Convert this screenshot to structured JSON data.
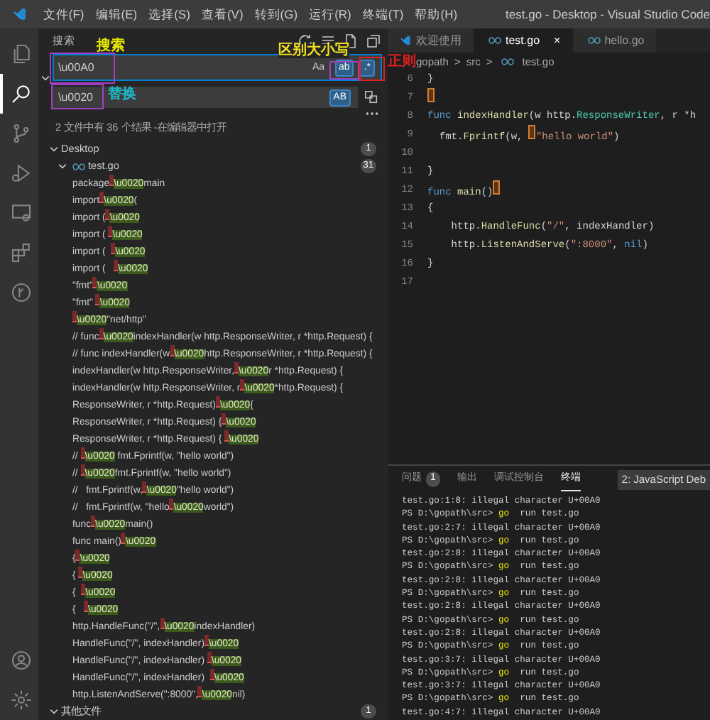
{
  "menu": [
    "文件(F)",
    "编辑(E)",
    "选择(S)",
    "查看(V)",
    "转到(G)",
    "运行(R)",
    "终端(T)",
    "帮助(H)"
  ],
  "window_title": "test.go - Desktop - Visual Studio Code",
  "activity_bar": [
    {
      "kind": "files",
      "selected": false
    },
    {
      "kind": "search",
      "selected": true
    },
    {
      "kind": "branch",
      "selected": false
    },
    {
      "kind": "run",
      "selected": false
    },
    {
      "kind": "monitor",
      "selected": false
    },
    {
      "kind": "extensions",
      "selected": false
    },
    {
      "kind": "fork",
      "selected": false
    }
  ],
  "activity_bottom": [
    {
      "kind": "account"
    },
    {
      "kind": "settings"
    }
  ],
  "sidebar": {
    "title": "搜索",
    "search": {
      "value": "\\u00A0",
      "toggles": [
        {
          "label": "Aa",
          "selected": false
        },
        {
          "label": "ab",
          "selected": true
        },
        {
          "label": ".*",
          "selected": true
        }
      ]
    },
    "replace": {
      "value": "\\u0020",
      "expanded": true,
      "toggles": [
        {
          "label": "AB",
          "selected": true
        }
      ]
    },
    "summary": "2 文件中有 36 个结果 - ",
    "summary_link": "在编辑器中打开",
    "groups": [
      {
        "label": "Desktop",
        "count": "1",
        "expanded": true,
        "files": [
          {
            "label": "test.go",
            "count": "31",
            "expanded": true,
            "matches": [
              {
                "before": "package",
                "replacement": "\\u0020",
                "after": "main"
              },
              {
                "before": "import",
                "replacement": "\\u0020",
                "after": "("
              },
              {
                "before": "import (",
                "replacement": "\\u0020"
              },
              {
                "before": "import ( ",
                "replacement": "\\u0020"
              },
              {
                "before": "import (  ",
                "replacement": "\\u0020"
              },
              {
                "before": "import (   ",
                "replacement": "\\u0020"
              },
              {
                "before": "\"fmt\"",
                "replacement": "\\u0020"
              },
              {
                "before": "\"fmt\" ",
                "replacement": "\\u0020"
              },
              {
                "replacement": "\\u0020",
                "after": "\"net/http\""
              },
              {
                "before": "// func",
                "replacement": "\\u0020",
                "after": "indexHandler(w http.ResponseWriter, r *http.Request) {"
              },
              {
                "before": "// func indexHandler(w",
                "replacement": "\\u0020",
                "after": "http.ResponseWriter, r *http.Request) {"
              },
              {
                "before": "indexHandler(w http.ResponseWriter,",
                "replacement": "\\u0020",
                "after": "r *http.Request) {"
              },
              {
                "before": "indexHandler(w http.ResponseWriter, r",
                "replacement": "\\u0020",
                "after": "*http.Request) {"
              },
              {
                "before": "ResponseWriter, r *http.Request)",
                "replacement": "\\u0020",
                "after": "{"
              },
              {
                "before": "ResponseWriter, r *http.Request) {",
                "replacement": "\\u0020"
              },
              {
                "before": "ResponseWriter, r *http.Request) { ",
                "replacement": "\\u0020"
              },
              {
                "before": "// ",
                "replacement": "\\u0020",
                "after": " fmt.Fprintf(w, \"hello world\")"
              },
              {
                "before": "// ",
                "replacement": "\\u0020",
                "after": "fmt.Fprintf(w, \"hello world\")"
              },
              {
                "before": "//   fmt.Fprintf(w,",
                "replacement": "\\u0020",
                "after": "\"hello world\")"
              },
              {
                "before": "//   fmt.Fprintf(w, \"hello",
                "replacement": "\\u0020",
                "after": "world\")"
              },
              {
                "before": "func",
                "replacement": "\\u0020",
                "after": "main()"
              },
              {
                "before": "func main()",
                "replacement": "\\u0020"
              },
              {
                "before": "{",
                "replacement": "\\u0020"
              },
              {
                "before": "{ ",
                "replacement": "\\u0020"
              },
              {
                "before": "{  ",
                "replacement": "\\u0020"
              },
              {
                "before": "{   ",
                "replacement": "\\u0020"
              },
              {
                "before": "http.HandleFunc(\"/\",",
                "replacement": "\\u0020",
                "after": "indexHandler)"
              },
              {
                "before": "HandleFunc(\"/\", indexHandler)",
                "replacement": "\\u0020"
              },
              {
                "before": "HandleFunc(\"/\", indexHandler) ",
                "replacement": "\\u0020"
              },
              {
                "before": "HandleFunc(\"/\", indexHandler)  ",
                "replacement": "\\u0020"
              },
              {
                "before": "http.ListenAndServe(\":8000\",",
                "replacement": "\\u0020",
                "after": "nil)"
              }
            ]
          }
        ]
      },
      {
        "label": "其他文件",
        "count": "1",
        "expanded": true
      }
    ]
  },
  "editor": {
    "tabs": [
      {
        "label": "欢迎使用",
        "kind": "welcome",
        "selected": false,
        "closable": false
      },
      {
        "label": "test.go",
        "kind": "go",
        "selected": true,
        "closable": true
      },
      {
        "label": "hello.go",
        "kind": "go",
        "selected": false,
        "closable": false
      }
    ],
    "close_glyph": "×",
    "breadcrumbs": [
      "gopath",
      "src",
      "test.go"
    ],
    "breadcrumb_separator": ">",
    "code": [
      {
        "number": "6",
        "tokens": [
          {
            "kind": "plain",
            "text": "}"
          }
        ]
      },
      {
        "number": "7",
        "tokens": [
          {
            "kind": "match"
          }
        ]
      },
      {
        "number": "8",
        "tokens": [
          {
            "kind": "kw",
            "text": "func"
          },
          {
            "kind": "fn",
            "text": " indexHandler"
          },
          {
            "kind": "plain",
            "text": "(w http."
          },
          {
            "kind": "type",
            "text": "ResponseWriter"
          },
          {
            "kind": "plain",
            "text": ", r *h"
          }
        ]
      },
      {
        "number": "9",
        "tokens": [
          {
            "kind": "plain",
            "text": "  fmt."
          },
          {
            "kind": "fn",
            "text": "Fprintf"
          },
          {
            "kind": "plain",
            "text": "(w, "
          },
          {
            "kind": "match"
          },
          {
            "kind": "str",
            "text": "\"hello world\""
          },
          {
            "kind": "plain",
            "text": ")"
          }
        ]
      },
      {
        "number": "10"
      },
      {
        "number": "11",
        "tokens": [
          {
            "kind": "plain",
            "text": "}"
          }
        ]
      },
      {
        "number": "12",
        "tokens": [
          {
            "kind": "kw",
            "text": "func"
          },
          {
            "kind": "fn",
            "text": " main"
          },
          {
            "kind": "plain",
            "text": "()"
          },
          {
            "kind": "match"
          }
        ]
      },
      {
        "number": "13",
        "tokens": [
          {
            "kind": "plain",
            "text": "{"
          }
        ]
      },
      {
        "number": "14",
        "tokens": [
          {
            "kind": "plain",
            "text": "    http."
          },
          {
            "kind": "fn",
            "text": "HandleFunc"
          },
          {
            "kind": "plain",
            "text": "("
          },
          {
            "kind": "str",
            "text": "\"/\""
          },
          {
            "kind": "plain",
            "text": ", indexHandler)"
          }
        ]
      },
      {
        "number": "15",
        "tokens": [
          {
            "kind": "plain",
            "text": "    http."
          },
          {
            "kind": "fn",
            "text": "ListenAndServe"
          },
          {
            "kind": "plain",
            "text": "("
          },
          {
            "kind": "str",
            "text": "\":8000\""
          },
          {
            "kind": "plain",
            "text": ", "
          },
          {
            "kind": "kw",
            "text": "nil"
          },
          {
            "kind": "plain",
            "text": ")"
          }
        ]
      },
      {
        "number": "16",
        "tokens": [
          {
            "kind": "plain",
            "text": "}"
          }
        ]
      },
      {
        "number": "17"
      }
    ]
  },
  "panel": {
    "tabs": [
      {
        "label": "问题",
        "badge": "1",
        "selected": false
      },
      {
        "label": "输出",
        "selected": false
      },
      {
        "label": "调试控制台",
        "selected": false
      },
      {
        "label": "终端",
        "selected": true
      }
    ],
    "terminal_select": "2: JavaScript Deb",
    "terminal": [
      {
        "kind": "error",
        "text": "test.go:1:8: illegal character U+00A0"
      },
      {
        "kind": "prompt",
        "prompt": "PS D:\\gopath\\src>",
        "command": "go",
        "args": "run test.go"
      },
      {
        "kind": "error",
        "text": "test.go:2:7: illegal character U+00A0"
      },
      {
        "kind": "prompt",
        "prompt": "PS D:\\gopath\\src>",
        "command": "go",
        "args": "run test.go"
      },
      {
        "kind": "error",
        "text": "test.go:2:8: illegal character U+00A0"
      },
      {
        "kind": "prompt",
        "prompt": "PS D:\\gopath\\src>",
        "command": "go",
        "args": "run test.go"
      },
      {
        "kind": "error",
        "text": "test.go:2:8: illegal character U+00A0"
      },
      {
        "kind": "prompt",
        "prompt": "PS D:\\gopath\\src>",
        "command": "go",
        "args": "run test.go"
      },
      {
        "kind": "error",
        "text": "test.go:2:8: illegal character U+00A0"
      },
      {
        "kind": "prompt",
        "prompt": "PS D:\\gopath\\src>",
        "command": "go",
        "args": "run test.go"
      },
      {
        "kind": "error",
        "text": "test.go:2:8: illegal character U+00A0"
      },
      {
        "kind": "prompt",
        "prompt": "PS D:\\gopath\\src>",
        "command": "go",
        "args": "run test.go"
      },
      {
        "kind": "error",
        "text": "test.go:3:7: illegal character U+00A0"
      },
      {
        "kind": "prompt",
        "prompt": "PS D:\\gopath\\src>",
        "command": "go",
        "args": "run test.go"
      },
      {
        "kind": "error",
        "text": "test.go:3:7: illegal character U+00A0"
      },
      {
        "kind": "prompt",
        "prompt": "PS D:\\gopath\\src>",
        "command": "go",
        "args": "run test.go"
      },
      {
        "kind": "error",
        "text": "test.go:4:7: illegal character U+00A0"
      }
    ]
  },
  "annotations": [
    {
      "text": "搜索",
      "color": "#e8e800"
    },
    {
      "text": "区别大小写",
      "color": "#f0e020"
    },
    {
      "text": "替换",
      "color": "#20b8c8"
    },
    {
      "text": "正则",
      "color": "#e02020"
    }
  ],
  "marker_boxes": [
    {
      "color": "#a040c0"
    },
    {
      "color": "#a040c0"
    },
    {
      "color": "#a040c0"
    },
    {
      "color": "#e02020"
    }
  ]
}
